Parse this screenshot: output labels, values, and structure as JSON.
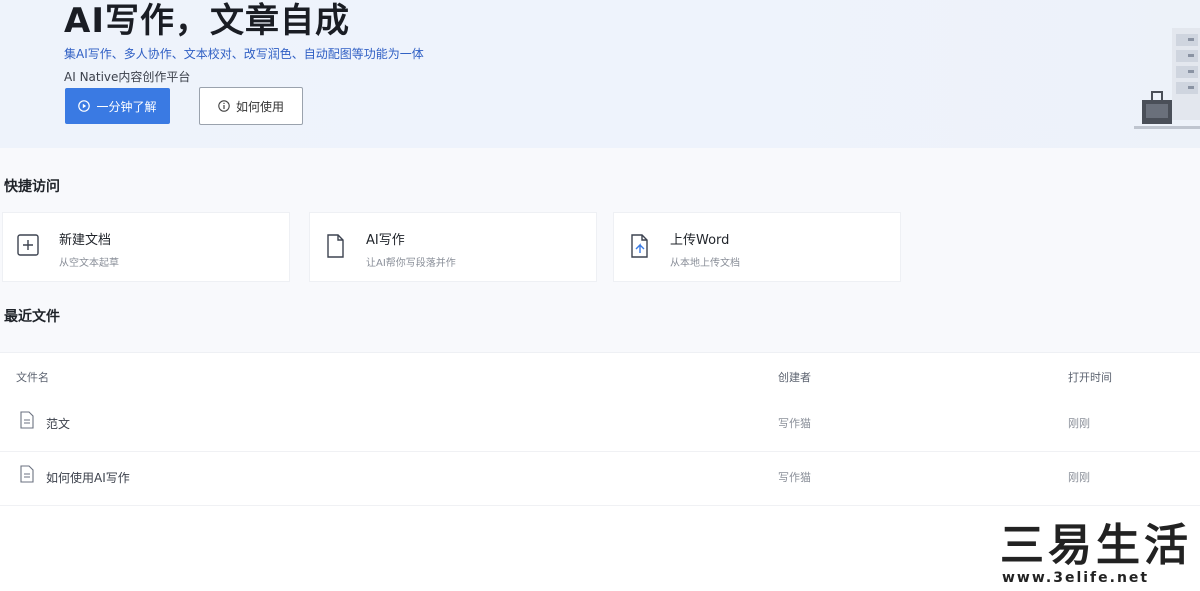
{
  "hero": {
    "title": "AI写作，文章自成",
    "subtitle": "集AI写作、多人协作、文本校对、改写润色、自动配图等功能为一体",
    "tagline": "AI Native内容创作平台",
    "primary_button": "一分钟了解",
    "secondary_button": "如何使用"
  },
  "quick_access": {
    "title": "快捷访问",
    "cards": [
      {
        "title": "新建文档",
        "desc": "从空文本起草"
      },
      {
        "title": "AI写作",
        "desc": "让AI帮你写段落并作"
      },
      {
        "title": "上传Word",
        "desc": "从本地上传文档"
      }
    ]
  },
  "recent": {
    "title": "最近文件",
    "columns": [
      "文件名",
      "创建者",
      "打开时间"
    ],
    "rows": [
      {
        "name": "范文",
        "creator": "写作猫",
        "time": "刚刚"
      },
      {
        "name": "如何使用AI写作",
        "creator": "写作猫",
        "time": "刚刚"
      }
    ]
  },
  "watermark": {
    "main": "三易生活",
    "url": "www.3elife.net"
  },
  "colors": {
    "accent": "#3a7ae3",
    "hero_bg": "#eef3fb"
  },
  "icons": {
    "play": "play-circle-icon",
    "info": "info-circle-icon",
    "new_doc": "plus-square-icon",
    "ai_write": "document-icon",
    "upload": "upload-document-icon",
    "file": "file-icon"
  }
}
